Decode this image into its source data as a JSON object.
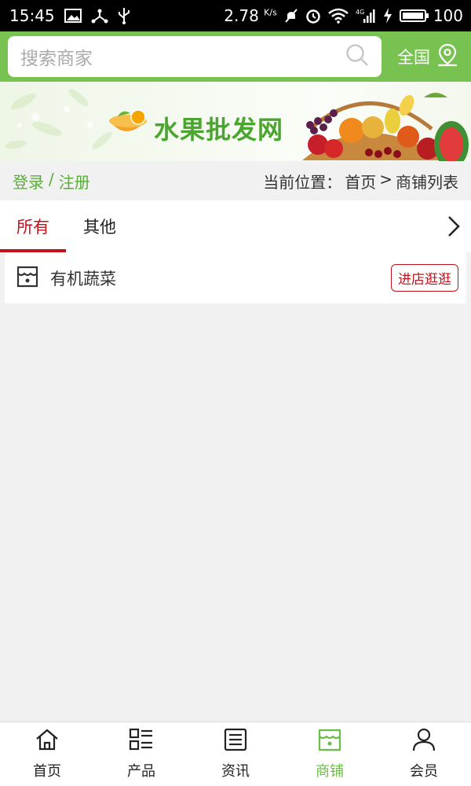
{
  "status_bar": {
    "time": "15:45",
    "net_speed": "2.78",
    "net_unit": "K/s",
    "battery": "100",
    "signal_label": "4G"
  },
  "search": {
    "placeholder": "搜索商家",
    "region_label": "全国"
  },
  "banner": {
    "title": "水果批发网"
  },
  "account": {
    "login": "登录",
    "separator": "/",
    "register": "注册"
  },
  "breadcrumb": {
    "prefix": "当前位置：",
    "home": "首页",
    "arrow": ">",
    "current": "商铺列表"
  },
  "tabs": [
    {
      "label": "所有"
    },
    {
      "label": "其他"
    }
  ],
  "stores": [
    {
      "name": "有机蔬菜",
      "action": "进店逛逛"
    }
  ],
  "bottom_nav": [
    {
      "label": "首页"
    },
    {
      "label": "产品"
    },
    {
      "label": "资讯"
    },
    {
      "label": "商铺"
    },
    {
      "label": "会员"
    }
  ],
  "colors": {
    "accent_green": "#78c251",
    "active_red": "#c3111b",
    "nav_active": "#6cbc4a"
  }
}
